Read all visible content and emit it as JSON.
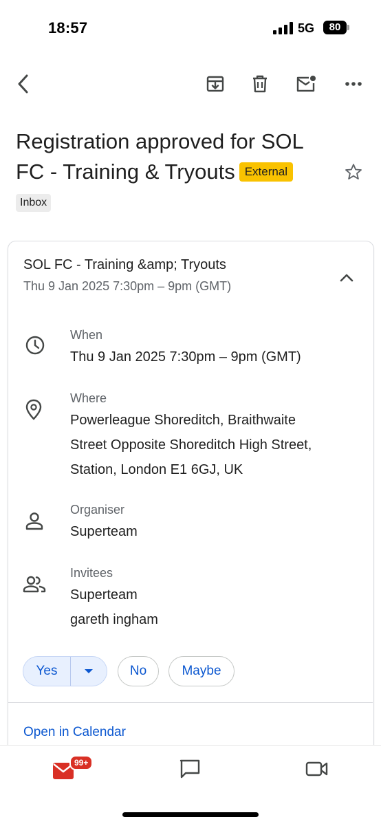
{
  "status_bar": {
    "time": "18:57",
    "network": "5G",
    "battery": "80"
  },
  "subject": {
    "text": "Registration approved for SOL FC - Training & Tryouts",
    "badge": "External"
  },
  "label_chip": "Inbox",
  "event": {
    "title": "SOL FC - Training &amp; Tryouts",
    "summary_time": "Thu 9 Jan 2025 7:30pm – 9pm (GMT)",
    "when_label": "When",
    "when_value": "Thu 9 Jan 2025 7:30pm – 9pm (GMT)",
    "where_label": "Where",
    "where_lines": [
      "Powerleague Shoreditch, Braithwaite",
      "Street Opposite Shoreditch High Street,",
      "Station, London E1 6GJ, UK"
    ],
    "organiser_label": "Organiser",
    "organiser_value": "Superteam",
    "invitees_label": "Invitees",
    "invitees": [
      "Superteam",
      "gareth ingham"
    ]
  },
  "rsvp": {
    "yes": "Yes",
    "no": "No",
    "maybe": "Maybe"
  },
  "open_calendar": "Open in Calendar",
  "bottom_nav": {
    "mail_badge": "99+"
  },
  "colors": {
    "accent": "#0b57d0",
    "external_badge": "#f9c200",
    "badge_red": "#d93025"
  }
}
